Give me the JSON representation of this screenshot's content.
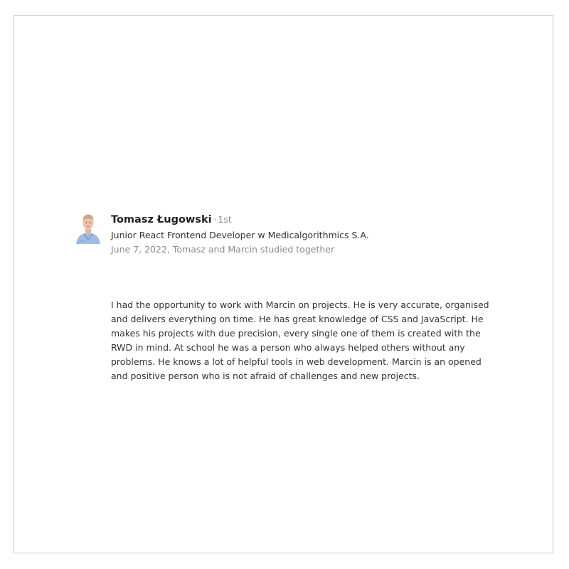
{
  "recommendation": {
    "author": {
      "name": "Tomasz Ługowski",
      "separator": "·",
      "degree": "1st",
      "headline": "Junior React Frontend Developer w Medicalgorithmics S.A.",
      "avatar_icon": "profile-photo-avatar"
    },
    "meta": "June 7, 2022, Tomasz and Marcin studied together",
    "text": "I had the opportunity to work with Marcin on projects. He is very accurate, organised and delivers everything on time. He has great knowledge of CSS and JavaScript. He makes his projects with due precision, every single one of them is created with the RWD in mind. At school he was a person who always helped others without any problems. He knows a lot of helpful tools in web development. Marcin is an opened and positive person who is not afraid of challenges and new projects."
  }
}
